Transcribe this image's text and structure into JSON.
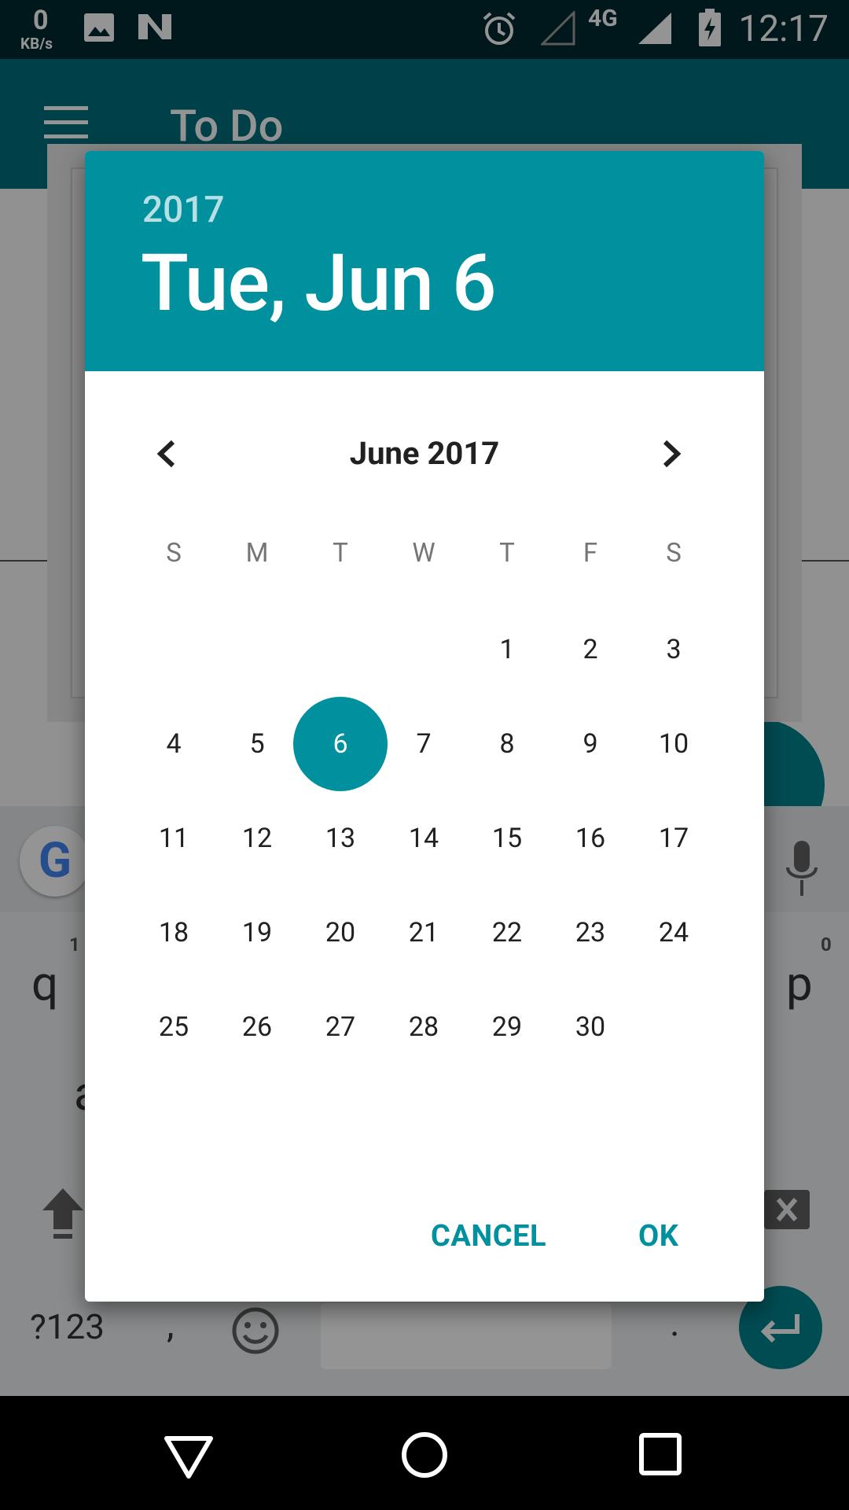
{
  "status_bar": {
    "net_speed": "0",
    "net_unit": "KB/s",
    "network_type": "4G",
    "time": "12:17",
    "icons": [
      "image-icon",
      "n-logo-icon",
      "alarm-icon",
      "signal-empty-icon",
      "signal-icon",
      "battery-charging-icon"
    ]
  },
  "app_bar": {
    "title": "To Do",
    "menu_icon": "hamburger-icon"
  },
  "keyboard": {
    "row1_left": "q",
    "row1_left_hint": "1",
    "row1_right": "p",
    "row1_right_hint": "0",
    "row2_left": "a",
    "symbols_key": "?123",
    "comma_key": ",",
    "period_key": ".",
    "accent_color": "#00838f"
  },
  "date_picker": {
    "header": {
      "year": "2017",
      "date": "Tue, Jun 6",
      "background_color": "#00909e"
    },
    "month_label": "June 2017",
    "prev_icon": "chevron-left-icon",
    "next_icon": "chevron-right-icon",
    "weekdays": [
      "S",
      "M",
      "T",
      "W",
      "T",
      "F",
      "S"
    ],
    "first_weekday_index": 4,
    "days_in_month": 30,
    "selected_day": 6,
    "cancel_label": "CANCEL",
    "ok_label": "OK"
  }
}
